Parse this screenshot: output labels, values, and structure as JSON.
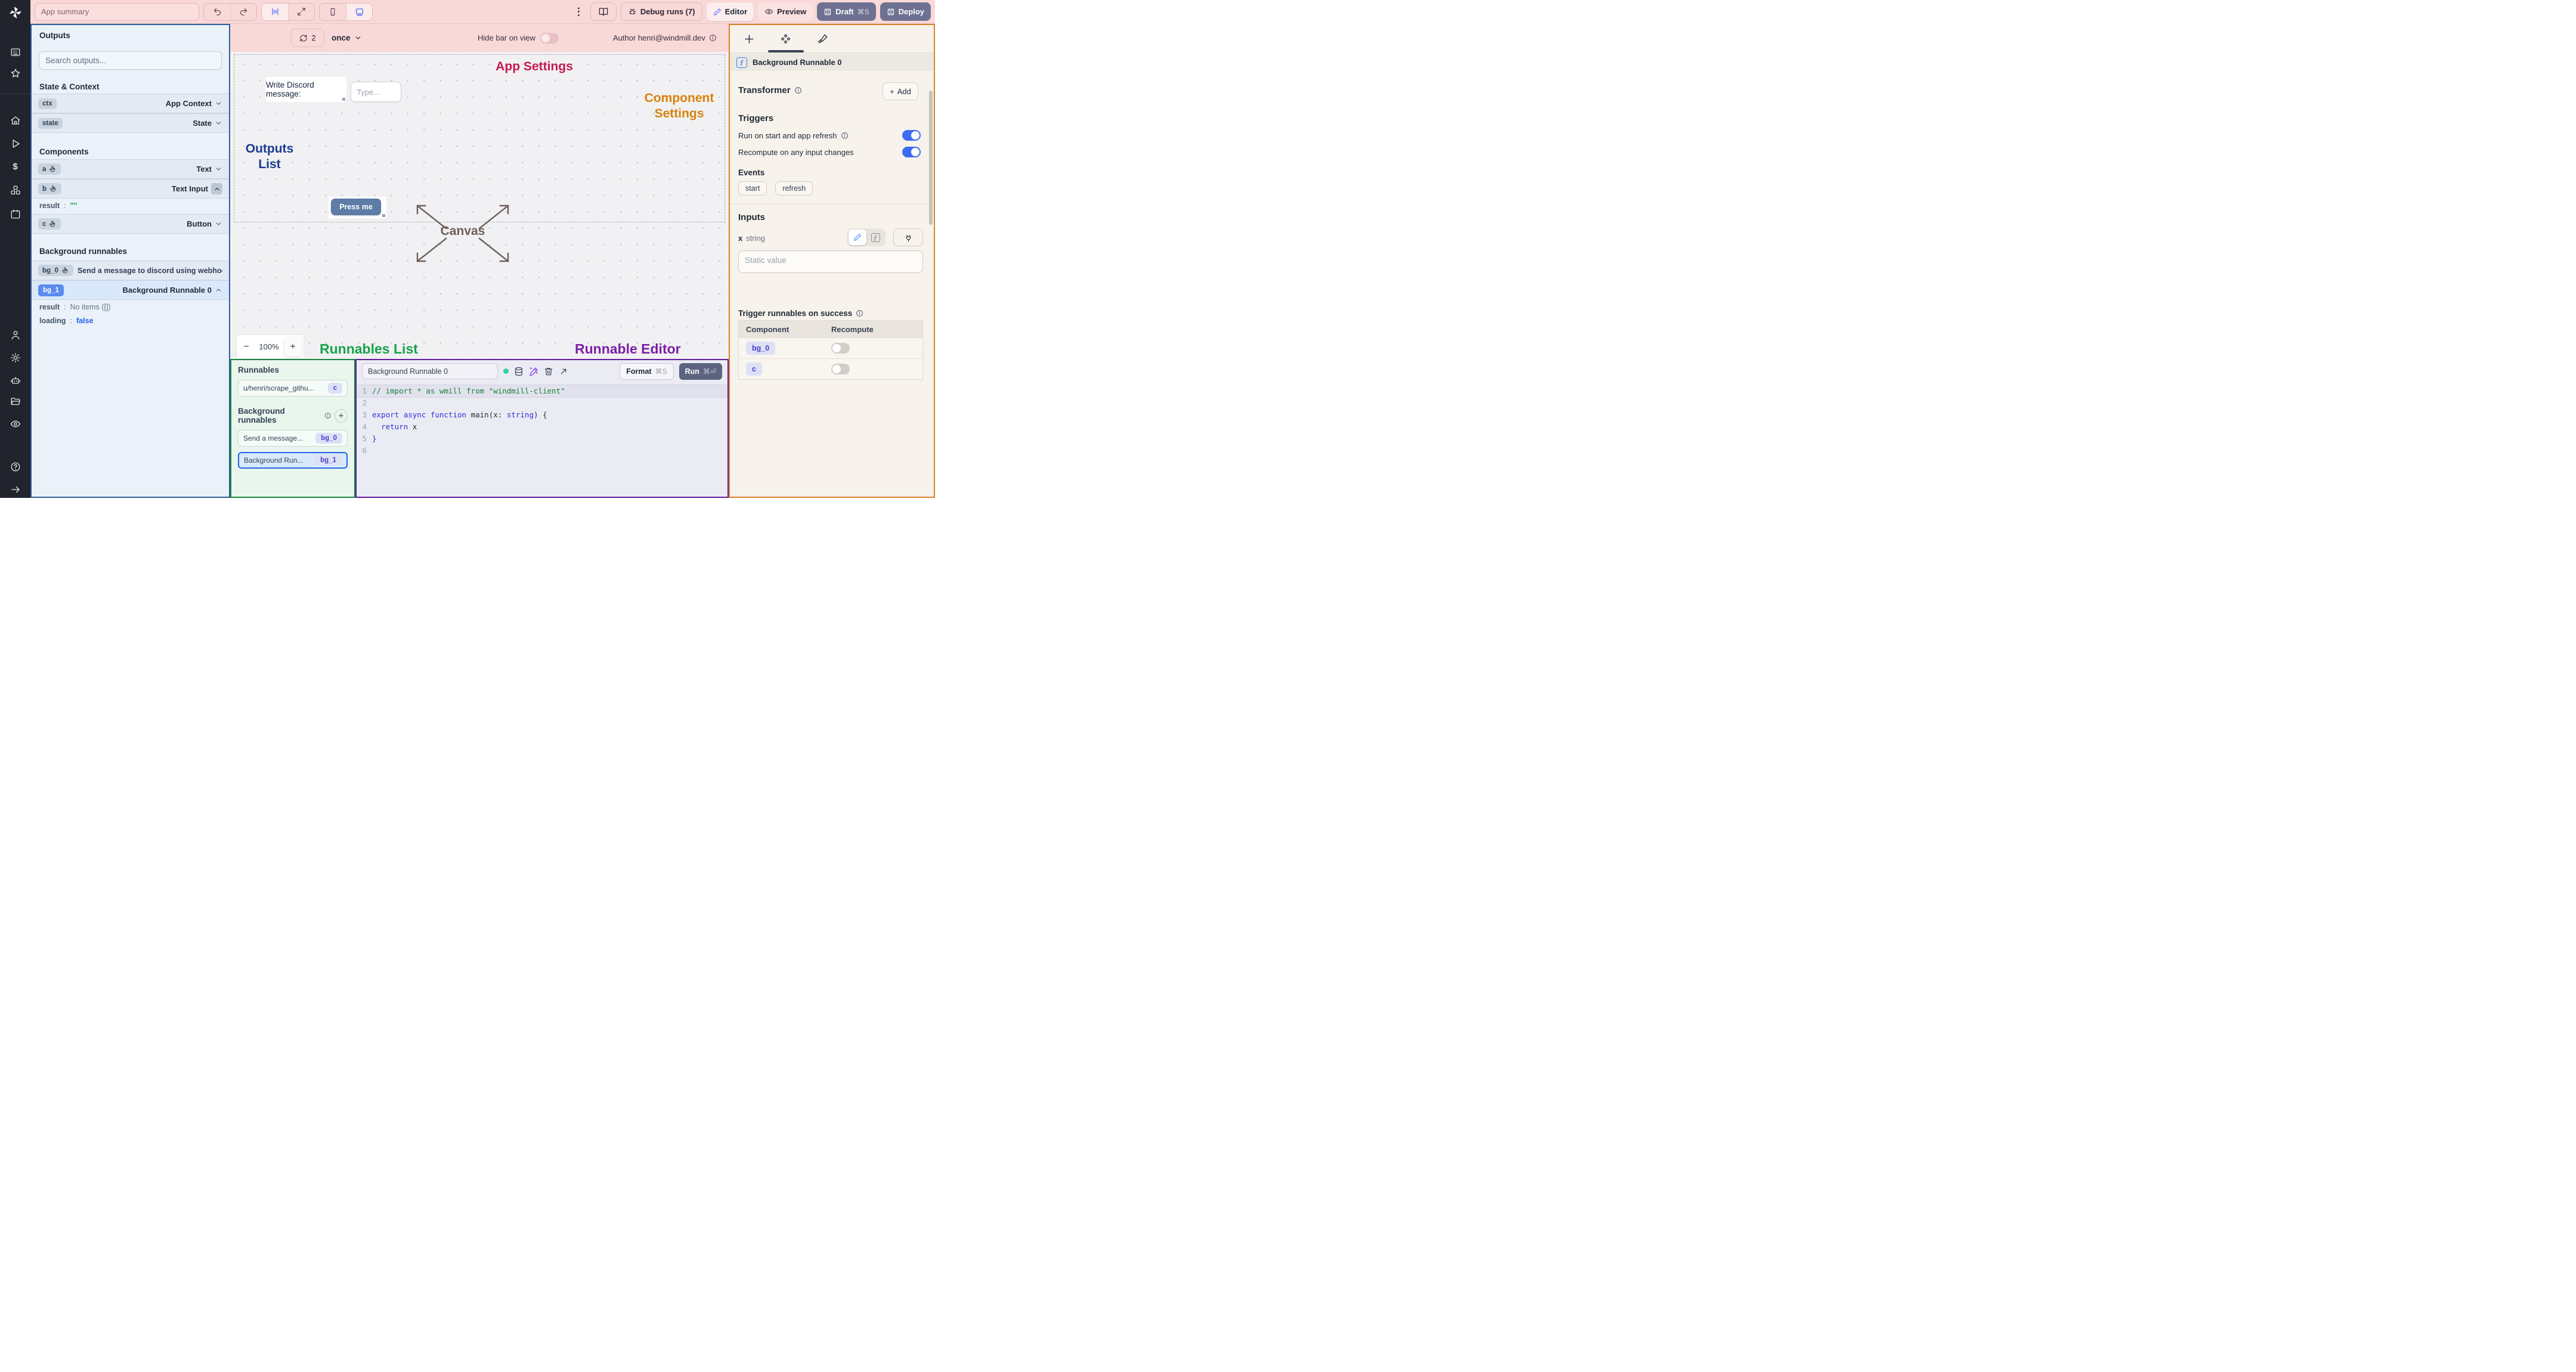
{
  "topbar": {
    "app_summary_placeholder": "App summary",
    "kebab_glyph": "⋮",
    "debug_runs_label": "Debug runs (7)",
    "editor_label": "Editor",
    "preview_label": "Preview",
    "draft_label": "Draft",
    "draft_shortcut": "⌘S",
    "deploy_label": "Deploy",
    "icons": [
      "undo",
      "redo",
      "align-center",
      "maximize",
      "smartphone",
      "desktop",
      "kebab-menu",
      "book",
      "bug",
      "pencil",
      "eye",
      "save"
    ]
  },
  "canvas_bar": {
    "refresh_count": "2",
    "schedule_mode": "once",
    "hide_bar_label": "Hide bar on view",
    "author_label": "Author henri@windmill.dev"
  },
  "outputs": {
    "title": "Outputs",
    "search_placeholder": "Search outputs...",
    "state_context_heading": "State & Context",
    "ctx_id": "ctx",
    "ctx_type": "App Context",
    "state_id": "state",
    "state_type": "State",
    "components_heading": "Components",
    "a_id": "a",
    "a_type": "Text",
    "b_id": "b",
    "b_type": "Text Input",
    "b_result_key": "result",
    "b_result_colon": ":",
    "b_result_value": "\"\"",
    "c_id": "c",
    "c_type": "Button",
    "bg_heading": "Background runnables",
    "bg0_id": "bg_0",
    "bg0_label": "Send a message to discord using webhoo",
    "bg1_id": "bg_1",
    "bg1_label": "Background Runnable 0",
    "bg1_result_key": "result",
    "bg1_result_value": "No items ([])",
    "bg1_loading_key": "loading",
    "bg1_loading_value": "false",
    "colon": ":"
  },
  "canvas": {
    "app_settings_label": "App Settings",
    "component_settings_line1": "Component",
    "component_settings_line2": "Settings",
    "outputs_list_line1": "Outputs",
    "outputs_list_line2": "List",
    "canvas_label": "Canvas",
    "discord_text": "Write Discord message:",
    "type_placeholder": "Type...",
    "press_me_label": "Press me",
    "zoom_out": "−",
    "zoom_level": "100%",
    "zoom_in": "+",
    "runnables_list_label": "Runnables List",
    "runnable_editor_label": "Runnable Editor"
  },
  "runnables": {
    "title": "Runnables",
    "script_label": "u/henri/scrape_githu...",
    "script_badge": "c",
    "bg_heading": "Background runnables",
    "add_glyph": "+",
    "item1_label": "Send a message...",
    "item1_badge": "bg_0",
    "item2_label": "Background Run...",
    "item2_badge": "bg_1"
  },
  "editor": {
    "name_value": "Background Runnable 0",
    "format_label": "Format",
    "format_shortcut": "⌘S",
    "run_label": "Run",
    "run_shortcut": "⌘⏎",
    "code": {
      "lines": [
        {
          "n": "1",
          "current": true,
          "tokens": [
            {
              "t": "// import * as wmill from \"windmill-client\"",
              "c": "comment"
            }
          ]
        },
        {
          "n": "2",
          "tokens": []
        },
        {
          "n": "3",
          "tokens": [
            {
              "t": "export",
              "c": "kw"
            },
            {
              "t": " ",
              "c": "pl"
            },
            {
              "t": "async",
              "c": "kw"
            },
            {
              "t": " ",
              "c": "pl"
            },
            {
              "t": "function",
              "c": "kw"
            },
            {
              "t": " main(x: ",
              "c": "pl"
            },
            {
              "t": "string",
              "c": "kw"
            },
            {
              "t": ") {",
              "c": "pl"
            }
          ]
        },
        {
          "n": "4",
          "tokens": [
            {
              "t": "  ",
              "c": "pl"
            },
            {
              "t": "return",
              "c": "kw"
            },
            {
              "t": " x",
              "c": "pl"
            }
          ]
        },
        {
          "n": "5",
          "tokens": [
            {
              "t": "}",
              "c": "kw"
            }
          ]
        },
        {
          "n": "6",
          "tokens": []
        }
      ]
    }
  },
  "settings": {
    "fx_glyph": "ƒ",
    "runnable_name": "Background Runnable 0",
    "transformer_heading": "Transformer",
    "add_plus": "+",
    "add_label": "Add",
    "triggers_heading": "Triggers",
    "run_on_start_label": "Run on start and app refresh",
    "recompute_label": "Recompute on any input changes",
    "events_heading": "Events",
    "event_pills": [
      "start",
      "refresh"
    ],
    "inputs_heading": "Inputs",
    "input_name": "x",
    "input_type": "string",
    "static_placeholder": "Static value",
    "trigger_success_heading": "Trigger runnables on success",
    "table": {
      "col1": "Component",
      "col2": "Recompute",
      "rows": [
        {
          "badge": "bg_0",
          "toggle": false
        },
        {
          "badge": "c",
          "toggle": false
        }
      ]
    }
  },
  "rail_icons": [
    "windmill-logo",
    "kanban-board",
    "star",
    "home",
    "play",
    "dollar",
    "boxes",
    "calendar",
    "user",
    "settings-gear",
    "robot",
    "folder-open",
    "eye",
    "help-circle",
    "arrow-right"
  ],
  "colors": {
    "accent_blue": "#3e6bf2",
    "pink_bar": "#f9d8d8",
    "crimson_label": "#c8184e",
    "amber_label": "#d9820b",
    "navy_label": "#1b3a8f",
    "green_label": "#17a34a",
    "purple_label": "#7c1fa6",
    "outputs_border": "#2e5f96",
    "runnables_border": "#16843c",
    "editor_border": "#641c9c",
    "settings_border": "#d9822b",
    "press_me_bg": "#5d7ca6"
  }
}
